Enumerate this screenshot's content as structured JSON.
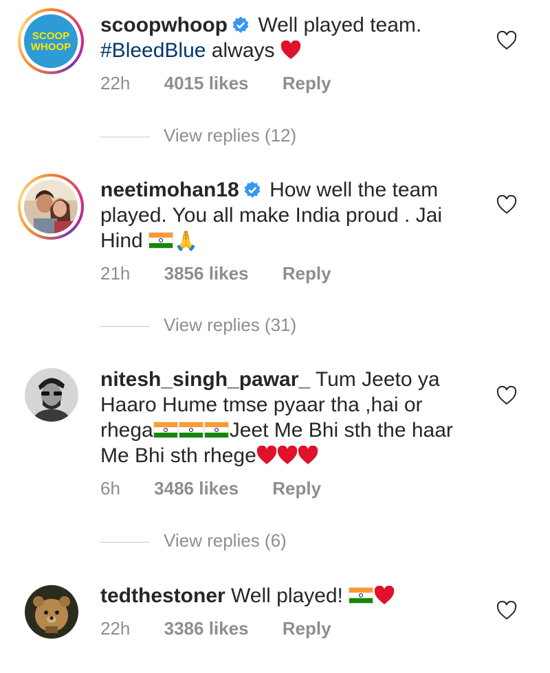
{
  "comments": [
    {
      "username": "scoopwhoop",
      "verified": true,
      "text_before": "Well played team.",
      "hashtag": "#BleedBlue",
      "text_after": " always",
      "time": "22h",
      "likes": "4015 likes",
      "reply": "Reply",
      "view_replies": "View replies (12)",
      "avatar_text": "SCOOP WHOOP"
    },
    {
      "username": "neetimohan18",
      "verified": true,
      "text": "How well the team played. You all make India proud . Jai Hind",
      "time": "21h",
      "likes": "3856 likes",
      "reply": "Reply",
      "view_replies": "View replies (31)"
    },
    {
      "username": "nitesh_singh_pawar_",
      "verified": false,
      "text_part1": "Tum Jeeto ya Haaro Hume tmse pyaar tha ,hai or rhega",
      "text_part2": "Jeet Me Bhi sth the haar Me Bhi sth rhege",
      "time": "6h",
      "likes": "3486 likes",
      "reply": "Reply",
      "view_replies": "View replies (6)"
    },
    {
      "username": "tedthestoner",
      "verified": false,
      "text": "Well played!",
      "time": "22h",
      "likes": "3386 likes",
      "reply": "Reply"
    }
  ],
  "colors": {
    "text": "#262626",
    "meta": "#8e8e8e",
    "hashtag": "#00376b",
    "verified": "#3897f0",
    "heart_emoji": "#e0112b"
  },
  "icons": {
    "like": "heart-outline-icon",
    "verified": "verified-badge-icon"
  }
}
